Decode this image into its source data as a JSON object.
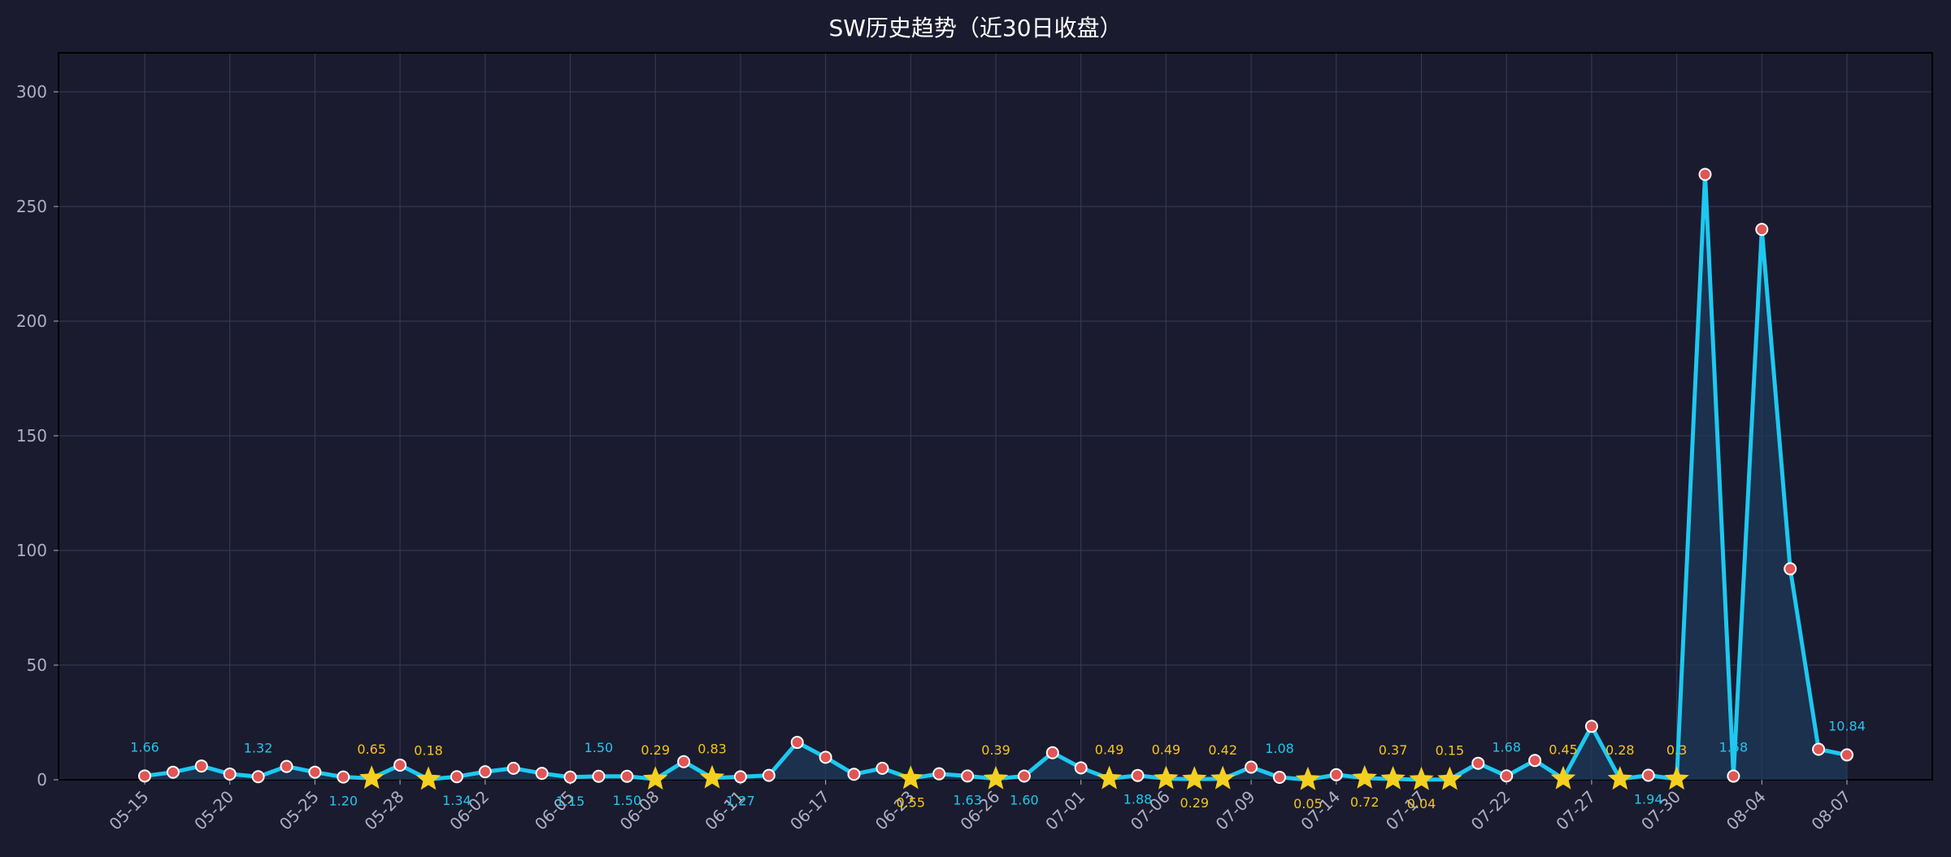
{
  "chart_data": {
    "type": "line",
    "title": "SW历史趋势（近30日收盘）",
    "xlabel": "",
    "ylabel": "",
    "ylim": [
      0,
      317
    ],
    "yticks": [
      0,
      50,
      100,
      150,
      200,
      250,
      300
    ],
    "grid": true,
    "colors": {
      "background": "#1a1b2e",
      "line": "#1ec8f0",
      "area": "#1e3a5a",
      "marker": "#e05555",
      "star": "#f5d020",
      "label_cyan": "#1ec8f0",
      "label_yellow": "#f5c518",
      "grid": "#3a3c55",
      "axis_text": "#aeb0c0",
      "title": "#ffffff"
    },
    "xticks": [
      "05-15",
      "05-20",
      "05-25",
      "05-28",
      "06-02",
      "06-05",
      "06-08",
      "06-11",
      "06-17",
      "06-23",
      "06-26",
      "07-01",
      "07-06",
      "07-09",
      "07-14",
      "07-17",
      "07-22",
      "07-27",
      "07-30",
      "08-04",
      "08-07"
    ],
    "xtick_index": [
      0,
      3,
      6,
      9,
      12,
      15,
      18,
      21,
      24,
      27,
      30,
      33,
      36,
      39,
      42,
      45,
      48,
      51,
      54,
      57,
      60
    ],
    "values": [
      1.66,
      3.3,
      6.0,
      2.5,
      1.32,
      5.8,
      3.3,
      1.2,
      0.65,
      6.4,
      0.18,
      1.34,
      3.5,
      5.0,
      2.8,
      1.15,
      1.5,
      1.5,
      0.29,
      7.9,
      0.83,
      1.27,
      1.9,
      16.3,
      9.8,
      2.4,
      5.0,
      0.55,
      2.6,
      1.63,
      0.39,
      1.6,
      11.8,
      5.2,
      0.49,
      1.88,
      0.49,
      0.29,
      0.42,
      5.5,
      1.08,
      0.05,
      2.2,
      0.72,
      0.37,
      0.04,
      0.15,
      7.2,
      1.68,
      8.4,
      0.45,
      23.3,
      0.28,
      1.94,
      0.3,
      264.0,
      1.58,
      240.0,
      92.0,
      13.3,
      10.84
    ],
    "star_points": [
      8,
      10,
      18,
      20,
      27,
      30,
      34,
      36,
      37,
      38,
      41,
      43,
      44,
      45,
      46,
      50,
      52,
      54
    ],
    "data_labels": [
      {
        "i": 0,
        "text": "1.66",
        "pos": "above",
        "color": "cyan"
      },
      {
        "i": 4,
        "text": "1.32",
        "pos": "above",
        "color": "cyan"
      },
      {
        "i": 7,
        "text": "1.20",
        "pos": "below",
        "color": "cyan"
      },
      {
        "i": 8,
        "text": "0.65",
        "pos": "above",
        "color": "yellow"
      },
      {
        "i": 10,
        "text": "0.18",
        "pos": "above",
        "color": "yellow"
      },
      {
        "i": 11,
        "text": "1.34",
        "pos": "below",
        "color": "cyan"
      },
      {
        "i": 15,
        "text": "1.15",
        "pos": "below",
        "color": "cyan"
      },
      {
        "i": 16,
        "text": "1.50",
        "pos": "above",
        "color": "cyan"
      },
      {
        "i": 17,
        "text": "1.50",
        "pos": "below",
        "color": "cyan"
      },
      {
        "i": 18,
        "text": "0.29",
        "pos": "above",
        "color": "yellow"
      },
      {
        "i": 20,
        "text": "0.83",
        "pos": "above",
        "color": "yellow"
      },
      {
        "i": 21,
        "text": "1.27",
        "pos": "below",
        "color": "cyan"
      },
      {
        "i": 27,
        "text": "0.55",
        "pos": "below",
        "color": "yellow"
      },
      {
        "i": 29,
        "text": "1.63",
        "pos": "below",
        "color": "cyan"
      },
      {
        "i": 30,
        "text": "0.39",
        "pos": "above",
        "color": "yellow"
      },
      {
        "i": 31,
        "text": "1.60",
        "pos": "below",
        "color": "cyan"
      },
      {
        "i": 34,
        "text": "0.49",
        "pos": "above",
        "color": "yellow"
      },
      {
        "i": 35,
        "text": "1.88",
        "pos": "below",
        "color": "cyan"
      },
      {
        "i": 36,
        "text": "0.49",
        "pos": "above",
        "color": "yellow"
      },
      {
        "i": 37,
        "text": "0.29",
        "pos": "below",
        "color": "yellow"
      },
      {
        "i": 38,
        "text": "0.42",
        "pos": "above",
        "color": "yellow"
      },
      {
        "i": 40,
        "text": "1.08",
        "pos": "above",
        "color": "cyan"
      },
      {
        "i": 41,
        "text": "0.05",
        "pos": "below",
        "color": "yellow"
      },
      {
        "i": 43,
        "text": "0.72",
        "pos": "below",
        "color": "yellow"
      },
      {
        "i": 44,
        "text": "0.37",
        "pos": "above",
        "color": "yellow"
      },
      {
        "i": 45,
        "text": "0.04",
        "pos": "below",
        "color": "yellow"
      },
      {
        "i": 46,
        "text": "0.15",
        "pos": "above",
        "color": "yellow"
      },
      {
        "i": 48,
        "text": "1.68",
        "pos": "above",
        "color": "cyan"
      },
      {
        "i": 50,
        "text": "0.45",
        "pos": "above",
        "color": "yellow"
      },
      {
        "i": 52,
        "text": "0.28",
        "pos": "above",
        "color": "yellow"
      },
      {
        "i": 53,
        "text": "1.94",
        "pos": "below",
        "color": "cyan"
      },
      {
        "i": 54,
        "text": "0.3",
        "pos": "above",
        "color": "yellow"
      },
      {
        "i": 56,
        "text": "1.58",
        "pos": "above",
        "color": "cyan"
      },
      {
        "i": 60,
        "text": "10.84",
        "pos": "above",
        "color": "cyan"
      }
    ]
  }
}
